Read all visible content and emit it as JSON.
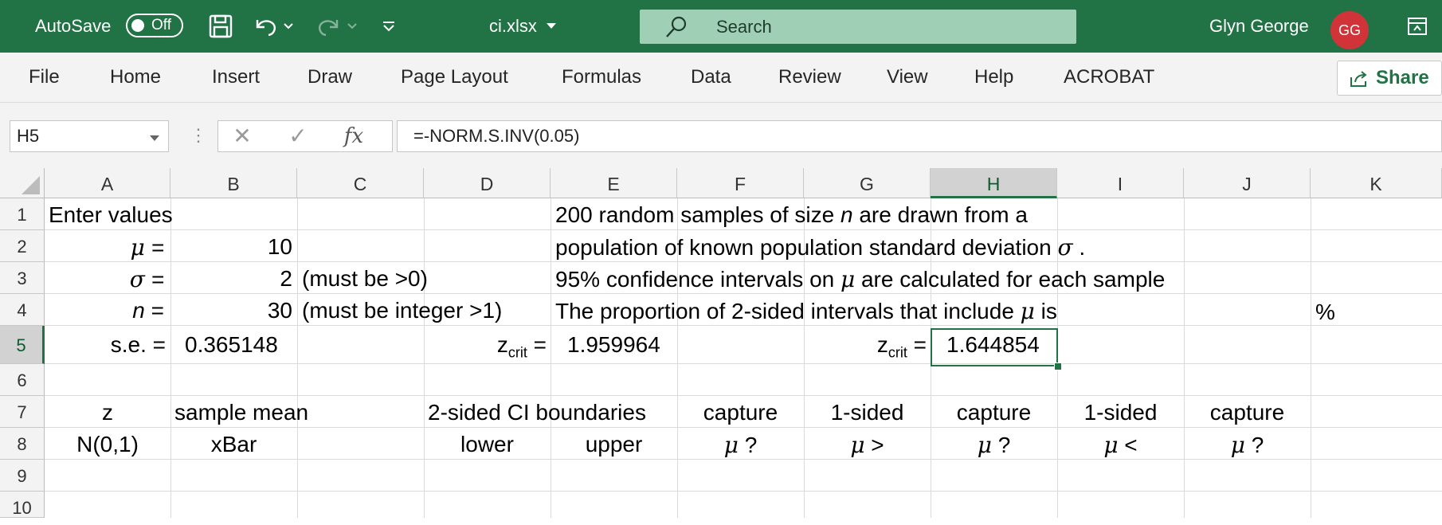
{
  "titlebar": {
    "autosave_label": "AutoSave",
    "autosave_state": "Off",
    "filename": "ci.xlsx",
    "search_placeholder": "Search",
    "user_name": "Glyn George",
    "user_initials": "GG",
    "accent": "#217346",
    "avatar_color": "#d13438"
  },
  "ribbon": {
    "tabs": [
      "File",
      "Home",
      "Insert",
      "Draw",
      "Page Layout",
      "Formulas",
      "Data",
      "Review",
      "View",
      "Help",
      "ACROBAT"
    ],
    "share_label": "Share"
  },
  "formula_bar": {
    "name_box": "H5",
    "fx_label": "fx",
    "formula": "=-NORM.S.INV(0.05)"
  },
  "grid": {
    "columns": [
      "A",
      "B",
      "C",
      "D",
      "E",
      "F",
      "G",
      "H",
      "I",
      "J",
      "K"
    ],
    "selected_column": "H",
    "rows": [
      "1",
      "2",
      "3",
      "4",
      "5",
      "6",
      "7",
      "8",
      "9",
      "10"
    ],
    "selected_row": "5",
    "cells": {
      "A1": "Enter values",
      "E1_pre": "200 random samples of size ",
      "E1_n": "n",
      "E1_post": " are drawn from a",
      "A2_mu": "μ",
      "A2_eq": " =",
      "B2": "10",
      "E2_pre": "population of known population standard deviation ",
      "E2_sigma": "σ",
      "E2_post": " .",
      "A3_sigma": "σ",
      "A3_eq": " =",
      "B3": "2",
      "C3": "(must be >0)",
      "E3_pre": "95% confidence intervals on ",
      "E3_mu": "μ",
      "E3_post": " are calculated for each sample",
      "A4_n": "n",
      "A4_eq": " =",
      "B4": "30",
      "C4": "(must be integer >1)",
      "E4_pre": "The proportion of 2-sided intervals that include ",
      "E4_mu": "μ",
      "E4_post": " is",
      "K4": "%",
      "A5": "s.e. =",
      "B5": "0.365148",
      "D5_z": "z",
      "D5_sub": "crit",
      "D5_eq": " =",
      "E5": "1.959964",
      "G5_z": "z",
      "G5_sub": "crit",
      "G5_eq": " =",
      "H5": "1.644854",
      "A7": "z",
      "B7": "sample mean",
      "D7": "2-sided CI boundaries",
      "F7": "capture",
      "G7": "1-sided",
      "H7": "capture",
      "I7": "1-sided",
      "J7": "capture",
      "A8": "N(0,1)",
      "B8": "xBar",
      "D8": "lower",
      "E8": "upper",
      "F8_mu": "μ",
      "F8_post": " ?",
      "G8_mu": "μ",
      "G8_post": " >",
      "H8_mu": "μ",
      "H8_post": " ?",
      "I8_mu": "μ",
      "I8_post": " <",
      "J8_mu": "μ",
      "J8_post": " ?"
    }
  }
}
